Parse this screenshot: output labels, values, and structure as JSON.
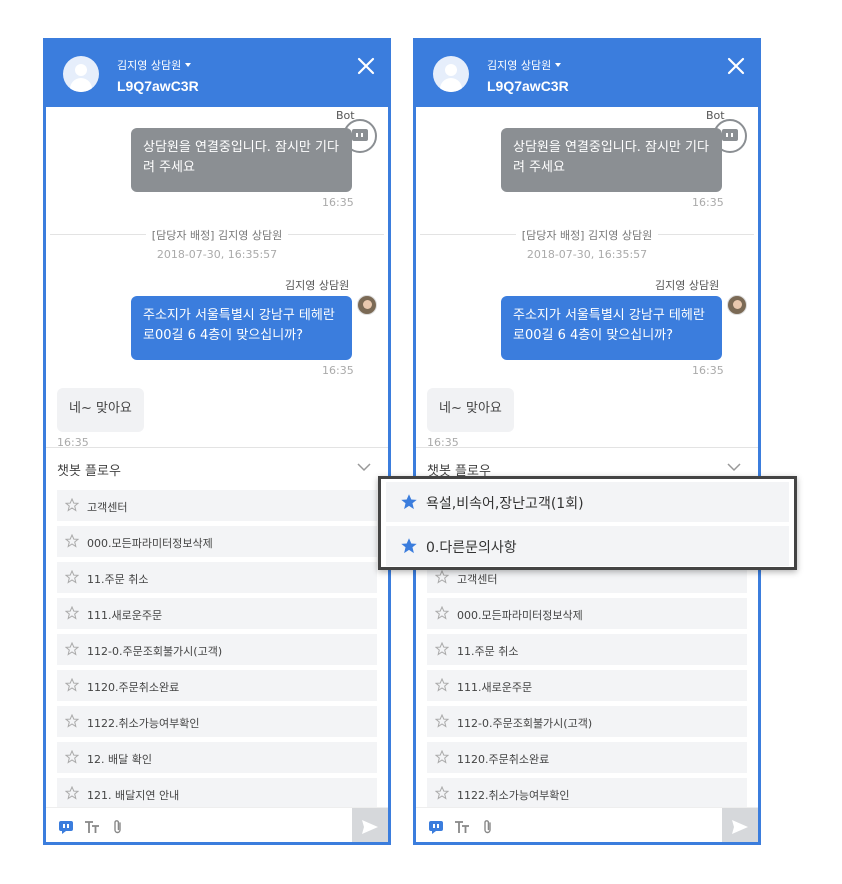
{
  "colors": {
    "accent": "#3b7ddd",
    "bot_bubble": "#8b8f93",
    "popup_border": "#444444"
  },
  "header": {
    "agent_label": "김지영 상담원",
    "session_code": "L9Q7awC3R"
  },
  "chat": {
    "bot_name": "Bot",
    "bot_message": "상담원을 연결중입니다. 잠시만 기다려 주세요",
    "bot_time": "16:35",
    "assign_notice": "[담당자 배정] 김지영 상담원",
    "assign_date": "2018-07-30, 16:35:57",
    "agent_name": "김지영 상담원",
    "agent_message": "주소지가 서울특별시 강남구 테헤란로00길 6 4층이 맞으십니까?",
    "agent_time": "16:35",
    "user_message": "네~ 맞아요",
    "user_time": "16:35"
  },
  "flow": {
    "title": "챗봇 플로우",
    "left_items": [
      "고객센터",
      "000.모든파라미터정보삭제",
      "11.주문 취소",
      "111.새로운주문",
      "112-0.주문조회불가시(고객)",
      "1120.주문취소완료",
      "1122.취소가능여부확인",
      "12. 배달 확인",
      "121. 배달지연 안내"
    ],
    "right_items": [
      "고객센터",
      "000.모든파라미터정보삭제",
      "11.주문 취소",
      "111.새로운주문",
      "112-0.주문조회불가시(고객)",
      "1120.주문취소완료",
      "1122.취소가능여부확인"
    ]
  },
  "favorites": [
    "욕설,비속어,장난고객(1회)",
    "0.다른문의사항"
  ],
  "icons": [
    "avatar-icon",
    "caret-down-icon",
    "close-icon",
    "bot-icon",
    "chevron-down-icon",
    "star-outline-icon",
    "star-filled-icon",
    "chatbot-icon",
    "text-format-icon",
    "paperclip-icon",
    "send-icon"
  ]
}
